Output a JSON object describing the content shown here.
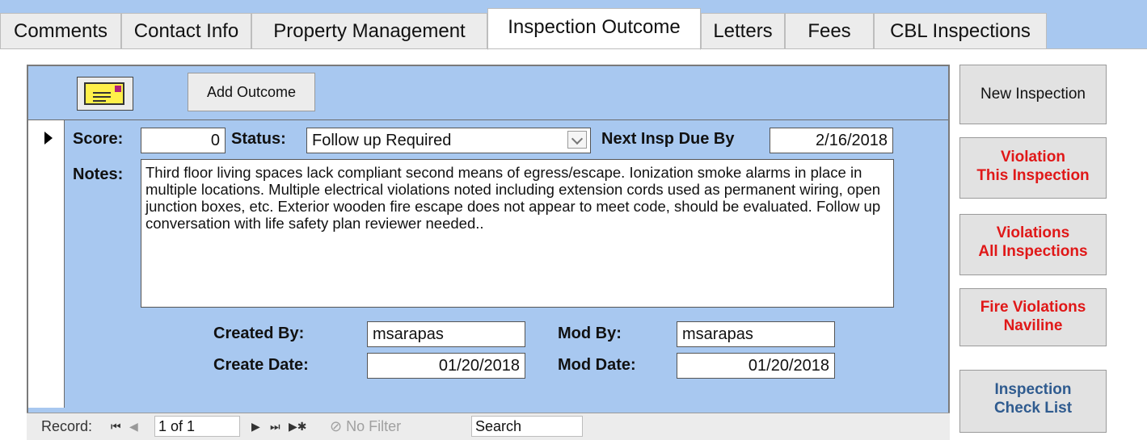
{
  "tabs": [
    {
      "label": "Comments"
    },
    {
      "label": "Contact Info"
    },
    {
      "label": "Property Management"
    },
    {
      "label": "Inspection Outcome"
    },
    {
      "label": "Letters"
    },
    {
      "label": "Fees"
    },
    {
      "label": "CBL Inspections"
    }
  ],
  "active_tab": "Inspection Outcome",
  "toolbar": {
    "email_icon": "envelope-icon",
    "add_outcome_label": "Add Outcome"
  },
  "record": {
    "score_label": "Score:",
    "score_value": "0",
    "status_label": "Status:",
    "status_value": "Follow up Required",
    "next_due_label": "Next Insp Due By",
    "next_due_value": "2/16/2018",
    "notes_label": "Notes:",
    "notes_value": "Third floor living spaces lack compliant second means of egress/escape. Ionization smoke alarms in place in multiple locations. Multiple electrical violations noted including extension cords used as permanent wiring, open junction boxes, etc. Exterior wooden fire escape does not appear to meet code, should be evaluated. Follow up conversation with life safety plan reviewer needed..",
    "created_by_label": "Created By:",
    "created_by_value": "msarapas",
    "create_date_label": "Create Date:",
    "create_date_value": "01/20/2018",
    "mod_by_label": "Mod By:",
    "mod_by_value": "msarapas",
    "mod_date_label": "Mod Date:",
    "mod_date_value": "01/20/2018"
  },
  "navigation": {
    "record_label": "Record:",
    "position": "1 of 1",
    "filter_label": "No Filter",
    "search_label": "Search"
  },
  "side_buttons": {
    "new_inspection": "New Inspection",
    "violation_this_line1": "Violation",
    "violation_this_line2": "This Inspection",
    "violations_all_line1": "Violations",
    "violations_all_line2": "All Inspections",
    "fire_violations_line1": "Fire Violations",
    "fire_violations_line2": "Naviline",
    "check_list_line1": "Inspection",
    "check_list_line2": "Check List"
  },
  "colors": {
    "panel_bg": "#a8c8f0",
    "alert_red": "#e01818",
    "link_blue": "#2f5b8f",
    "envelope_yellow": "#fff04a"
  }
}
